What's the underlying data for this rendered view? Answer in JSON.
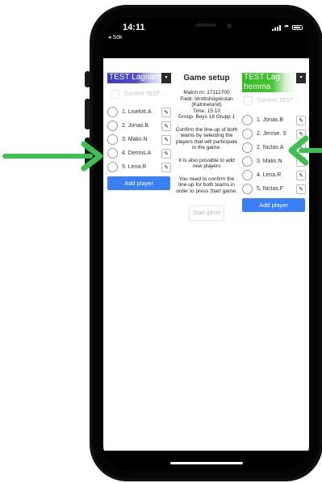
{
  "status_bar": {
    "time": "14:11",
    "back_label": "◂ Sök"
  },
  "game_setup": {
    "title": "Game setup",
    "match_nr": "Match nr: 17112700",
    "field": "Field: Idrottshögskolan",
    "field_sub": "(Katrinelund)",
    "time": "Time: 15:10",
    "group": "Group: Boys 18 Grupp 1",
    "instruction_confirm": "Confirm the line-up of both teams by selecting the players that will participate in the game.",
    "instruction_add": "It is also possible to add new players",
    "instruction_start": "You need to confirm the line-up for both teams in order to press Start game.",
    "start_button": "Start game"
  },
  "team_left": {
    "name": "TEST Lagnamn",
    "dropdown_icon": "▾",
    "confirm_label": "Confirm TEST ...",
    "players": [
      {
        "label": "1. Liselott.A",
        "edit_icon": "✎"
      },
      {
        "label": "2. Jonas.B",
        "edit_icon": "✎"
      },
      {
        "label": "3. Malin.N",
        "edit_icon": "✎"
      },
      {
        "label": "4. Dennis.A",
        "edit_icon": "✎"
      },
      {
        "label": "5. Lena.R",
        "edit_icon": "✎"
      }
    ],
    "add_button": "Add player",
    "color": "#3b3bbf"
  },
  "team_right": {
    "name": "TEST Lag hemma",
    "dropdown_icon": "▾",
    "confirm_label": "Confirm TEST ...",
    "players": [
      {
        "label": "1. Jonas.B",
        "edit_icon": "✎"
      },
      {
        "label": "2. Jennie. S",
        "edit_icon": "✎"
      },
      {
        "label": "2. Niclas.A",
        "edit_icon": "✎"
      },
      {
        "label": "3. Malin.N",
        "edit_icon": "✎"
      },
      {
        "label": "4. Lena.R",
        "edit_icon": "✎"
      },
      {
        "label": "5. Niclas.F",
        "edit_icon": "✎"
      }
    ],
    "add_button": "Add player",
    "color": "#33bb22"
  },
  "annotation_color": "#3fbf4f"
}
